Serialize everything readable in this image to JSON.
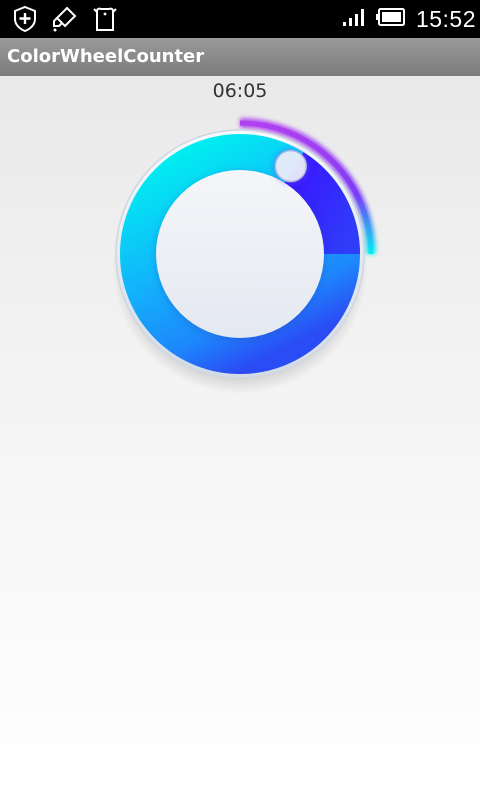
{
  "status_bar": {
    "time": "15:52",
    "icons": [
      "shield-plus-icon",
      "usb-debug-icon",
      "android-bear-icon",
      "signal-icon",
      "battery-icon"
    ]
  },
  "action_bar": {
    "title": "ColorWheelCounter"
  },
  "counter": {
    "time_display": "06:05",
    "progress_fraction": 0.25,
    "colors": {
      "cyan": "#00f0f0",
      "blue": "#2a4cf5",
      "violet": "#3a16ff",
      "purple": "#b040f0",
      "face": "#eceef4"
    }
  }
}
